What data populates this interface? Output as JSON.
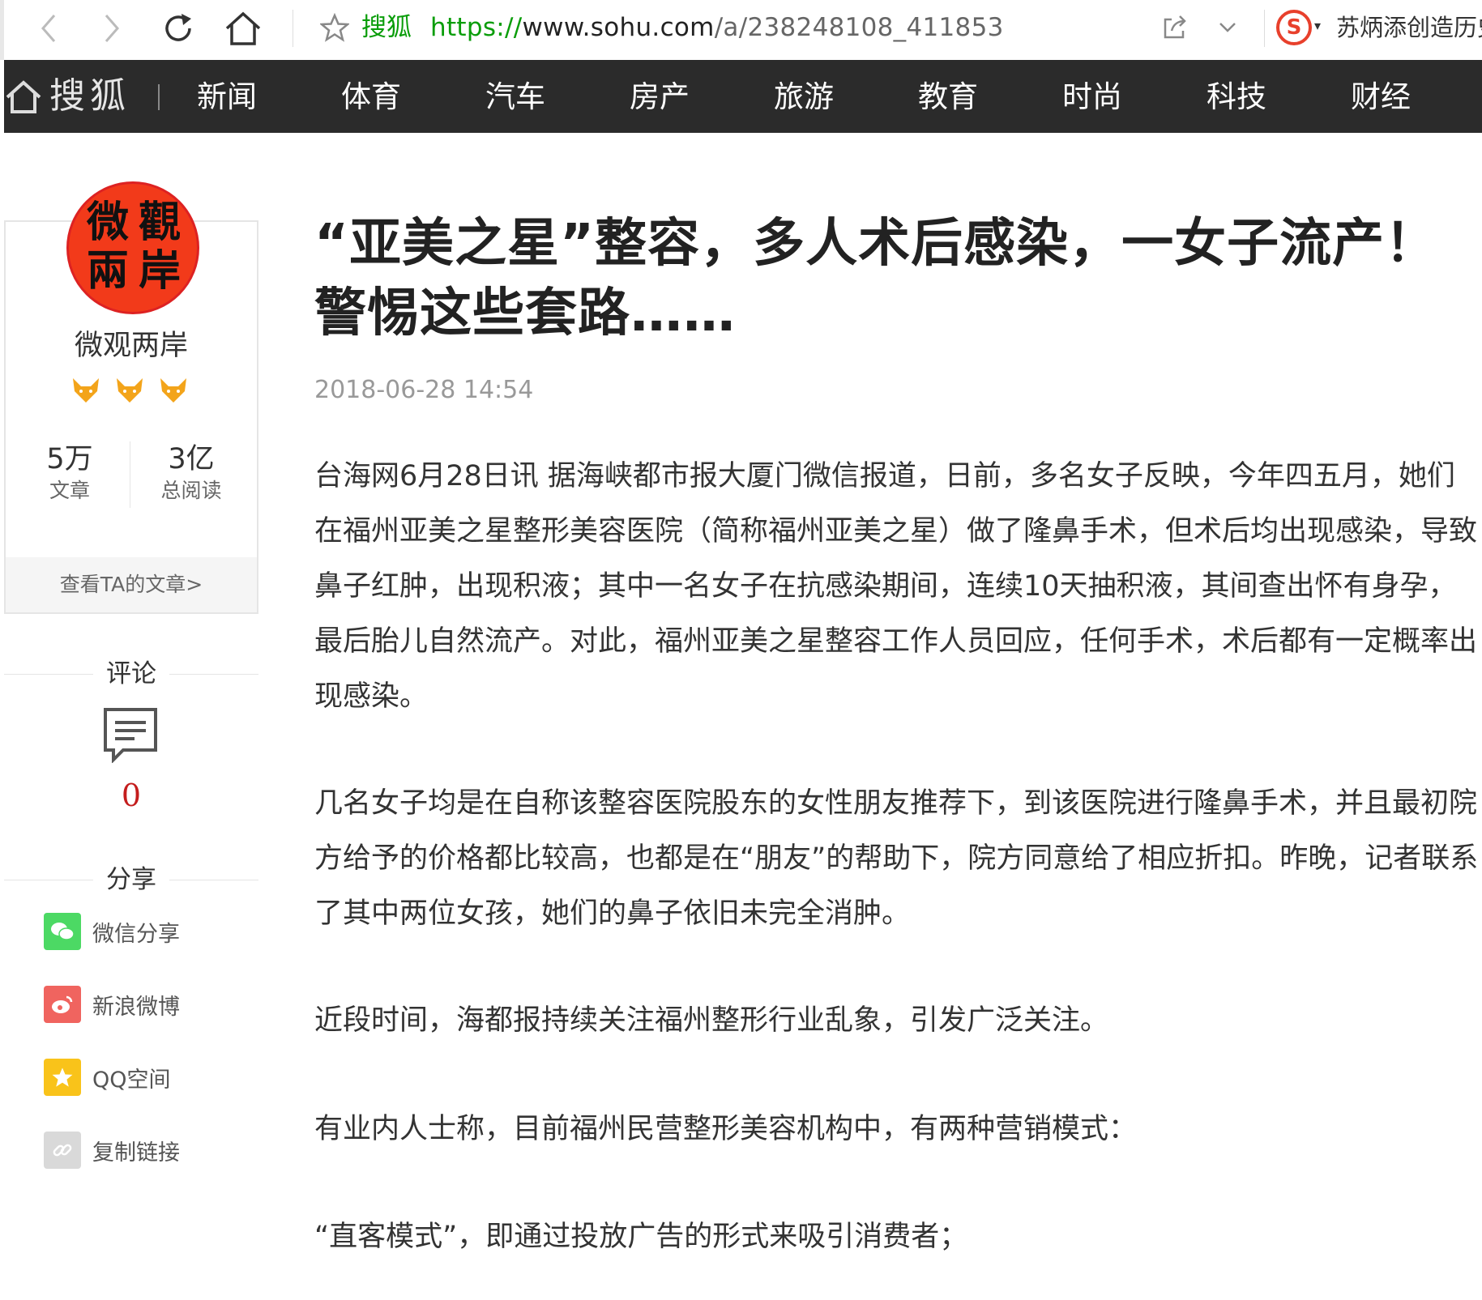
{
  "browser": {
    "site_name": "搜狐",
    "url_scheme": "https://",
    "url_domain": "www.sohu.com",
    "url_path": "/a/238248108_411853",
    "ticker": "苏炳添创造历史"
  },
  "topnav": {
    "logo": "搜狐",
    "items": [
      "新闻",
      "体育",
      "汽车",
      "房产",
      "旅游",
      "教育",
      "时尚",
      "科技",
      "财经"
    ]
  },
  "author": {
    "avatar_chars": [
      "微",
      "觀",
      "兩",
      "岸"
    ],
    "name": "微观两岸",
    "badge_count": 3,
    "articles_count": "5万",
    "articles_label": "文章",
    "reads_count": "3亿",
    "reads_label": "总阅读",
    "view_link": "查看TA的文章>"
  },
  "comments": {
    "label": "评论",
    "count": "0"
  },
  "share": {
    "label": "分享",
    "items": [
      {
        "label": "微信分享",
        "color": "#4cd964"
      },
      {
        "label": "新浪微博",
        "color": "#f0645f"
      },
      {
        "label": "QQ空间",
        "color": "#f9c31a"
      },
      {
        "label": "复制链接",
        "color": "#d9d9d9"
      }
    ]
  },
  "article": {
    "title": "“亚美之星”整容，多人术后感染，一女子流产！警惕这些套路……",
    "date": "2018-06-28 14:54",
    "paragraphs": [
      "台海网6月28日讯 据海峡都市报大厦门微信报道，日前，多名女子反映，今年四五月，她们在福州亚美之星整形美容医院（简称福州亚美之星）做了隆鼻手术，但术后均出现感染，导致鼻子红肿，出现积液；其中一名女子在抗感染期间，连续10天抽积液，其间查出怀有身孕，最后胎儿自然流产。对此，福州亚美之星整容工作人员回应，任何手术，术后都有一定概率出现感染。",
      "几名女子均是在自称该整容医院股东的女性朋友推荐下，到该医院进行隆鼻手术，并且最初院方给予的价格都比较高，也都是在“朋友”的帮助下，院方同意给了相应折扣。昨晚，记者联系了其中两位女孩，她们的鼻子依旧未完全消肿。",
      "近段时间，海都报持续关注福州整形行业乱象，引发广泛关注。",
      "有业内人士称，目前福州民营整形美容机构中，有两种营销模式：",
      "“直客模式”，即通过投放广告的形式来吸引消费者；"
    ]
  }
}
